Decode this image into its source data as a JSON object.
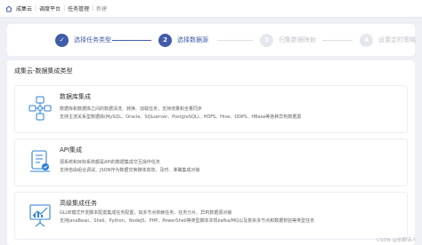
{
  "breadcrumb": {
    "items": [
      "成集云",
      "调度平台",
      "任务管理",
      "新建"
    ]
  },
  "steps": [
    {
      "number": "✓",
      "label": "选择任务类型",
      "state": "done"
    },
    {
      "number": "2",
      "label": "选择数据源",
      "state": "active"
    },
    {
      "number": "3",
      "label": "归集数据映射",
      "state": "todo"
    },
    {
      "number": "4",
      "label": "设置定时策略",
      "state": "todo"
    }
  ],
  "main": {
    "section_title": "成集云-数据集成类型",
    "items": [
      {
        "icon": "database-network-icon",
        "title": "数据库集成",
        "desc": [
          "数据库和数据库之间的数据清洗、转换、加载任务，支持增量和全量同步",
          "支持主流关系型数据库(MySQL、Oracle、SQLserver、PostgreSQL)、HDFS、Hive、ODPS、HBase等各种异构数据源"
        ]
      },
      {
        "icon": "api-monitor-icon",
        "title": "API集成",
        "desc": [
          "源系统和目标系统都是API的数据集成交互操作任务",
          "支持自由组合调试、JSON作为数据交换媒体高效、及时、准确集成对接"
        ]
      },
      {
        "icon": "presentation-chart-icon",
        "title": "高级集成任务",
        "desc": [
          "GLUE模式开发脚本配置集成任务配置，如多节点依赖任务、任务分片、异构数据源对接",
          "支持JavaBean、Shell、Python、NodeJS、PHP、PowerShell等类型脚本实现kafka/MQ以及复杂多节点和数据校验等类型任务"
        ]
      }
    ]
  },
  "watermark": "CSDN @依颗诗人",
  "colors": {
    "primary": "#3f5ba9",
    "accent_blue": "#2f7fd6"
  }
}
